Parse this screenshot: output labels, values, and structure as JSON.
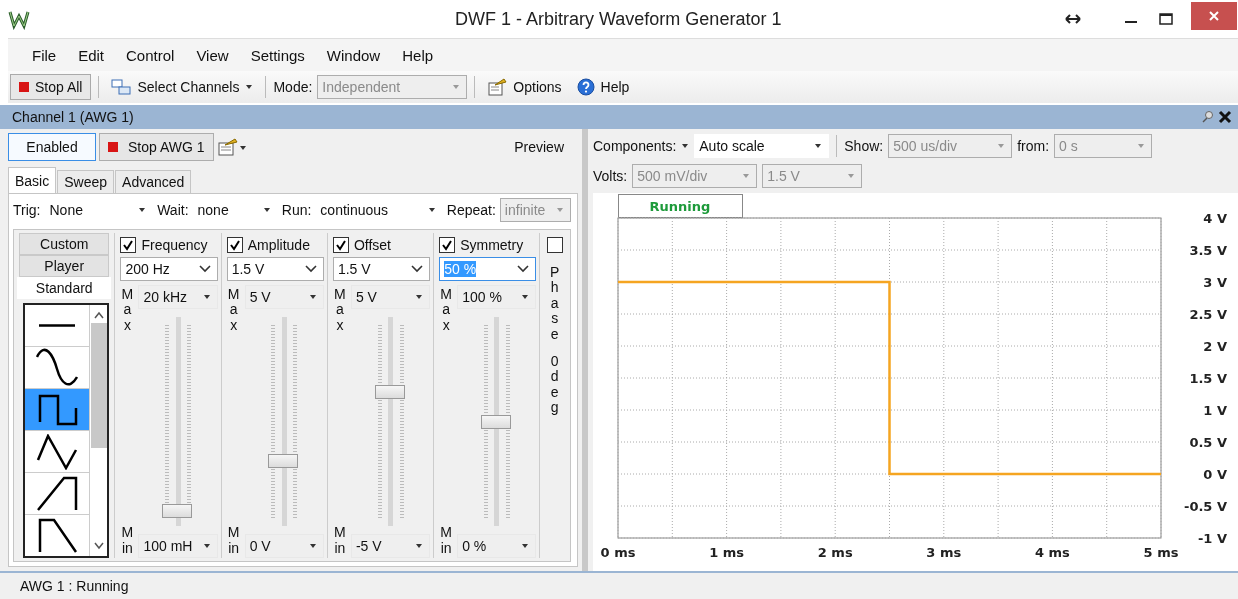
{
  "window": {
    "title": "DWF 1 - Arbitrary Waveform Generator 1"
  },
  "menu": [
    "File",
    "Edit",
    "Control",
    "View",
    "Settings",
    "Window",
    "Help"
  ],
  "toolbar": {
    "stop_all": "Stop All",
    "select_channels": "Select Channels",
    "mode_label": "Mode:",
    "mode": {
      "value": "Independent",
      "disabled": true
    },
    "options": "Options",
    "help": "Help"
  },
  "channel_panel": {
    "title": "Channel 1 (AWG 1)",
    "enabled_button": "Enabled",
    "stop_button": "Stop AWG 1",
    "preview_label": "Preview"
  },
  "tabs": [
    {
      "label": "Basic",
      "selected": true
    },
    {
      "label": "Sweep",
      "selected": false
    },
    {
      "label": "Advanced",
      "selected": false
    }
  ],
  "trigger_row": [
    {
      "label": "Trig:",
      "value": "None",
      "disabled": false
    },
    {
      "label": "Wait:",
      "value": "none",
      "disabled": false
    },
    {
      "label": "Run:",
      "value": "continuous",
      "disabled": false
    },
    {
      "label": "Repeat:",
      "value": "infinite",
      "disabled": true
    }
  ],
  "signal_tabs": [
    {
      "label": "Custom",
      "selected": false
    },
    {
      "label": "Player",
      "selected": false
    },
    {
      "label": "Standard",
      "selected": true
    }
  ],
  "waveforms": [
    {
      "kind": "flat",
      "selected": false
    },
    {
      "kind": "sine",
      "selected": false
    },
    {
      "kind": "square",
      "selected": true
    },
    {
      "kind": "triangle",
      "selected": false
    },
    {
      "kind": "ramp_up",
      "selected": false
    },
    {
      "kind": "ramp_down",
      "selected": false
    }
  ],
  "parameters": [
    {
      "label": "Frequency",
      "checked": true,
      "value": "200 Hz",
      "focused": false,
      "max_label": "Max",
      "max_value": "20 kHz",
      "min_label": "Min",
      "min_value": "100 mH",
      "level": 0.04
    },
    {
      "label": "Amplitude",
      "checked": true,
      "value": "1.5 V",
      "focused": false,
      "max_label": "Max",
      "max_value": "5 V",
      "min_label": "Min",
      "min_value": "0 V",
      "level": 0.3
    },
    {
      "label": "Offset",
      "checked": true,
      "value": "1.5 V",
      "focused": false,
      "max_label": "Max",
      "max_value": "5 V",
      "min_label": "Min",
      "min_value": "-5 V",
      "level": 0.65
    },
    {
      "label": "Symmetry",
      "checked": true,
      "value": "50 %",
      "focused": true,
      "max_label": "Max",
      "max_value": "100 %",
      "min_label": "Min",
      "min_value": "0 %",
      "level": 0.5
    }
  ],
  "phase": {
    "checked": false,
    "label": "Phase",
    "value": "0 deg"
  },
  "preview": {
    "components_label": "Components:",
    "scale": {
      "value": "Auto scale",
      "disabled": false
    },
    "show_label": "Show:",
    "show": {
      "value": "500 us/div",
      "disabled": true
    },
    "from_label": "from:",
    "from": {
      "value": "0 s",
      "disabled": true
    },
    "volts_label": "Volts:",
    "volts": {
      "value": "500 mV/div",
      "disabled": true
    },
    "volts_offset": {
      "value": "1.5 V",
      "disabled": true
    },
    "status": "Running",
    "chart_data": {
      "type": "line",
      "grid": true,
      "x": [
        0,
        2.5,
        2.5,
        5
      ],
      "series": [
        {
          "color": "#f5a521",
          "values": [
            3,
            3,
            0,
            0
          ]
        }
      ],
      "xlim": [
        0,
        5
      ],
      "ylim": [
        -1,
        4
      ],
      "xticks": [
        {
          "value": 0,
          "label": "0 ms"
        },
        {
          "value": 1,
          "label": "1 ms"
        },
        {
          "value": 2,
          "label": "2 ms"
        },
        {
          "value": 3,
          "label": "3 ms"
        },
        {
          "value": 4,
          "label": "4 ms"
        },
        {
          "value": 5,
          "label": "5 ms"
        }
      ],
      "yticks": [
        {
          "value": 4,
          "label": "4 V"
        },
        {
          "value": 3.5,
          "label": "3.5 V"
        },
        {
          "value": 3,
          "label": "3 V"
        },
        {
          "value": 2.5,
          "label": "2.5 V"
        },
        {
          "value": 2,
          "label": "2 V"
        },
        {
          "value": 1.5,
          "label": "1.5 V"
        },
        {
          "value": 1,
          "label": "1 V"
        },
        {
          "value": 0.5,
          "label": "0.5 V"
        },
        {
          "value": 0,
          "label": "0 V"
        },
        {
          "value": -0.5,
          "label": "-0.5 V"
        },
        {
          "value": -1,
          "label": "-1 V"
        }
      ]
    }
  },
  "status_bar": "AWG 1 : Running"
}
